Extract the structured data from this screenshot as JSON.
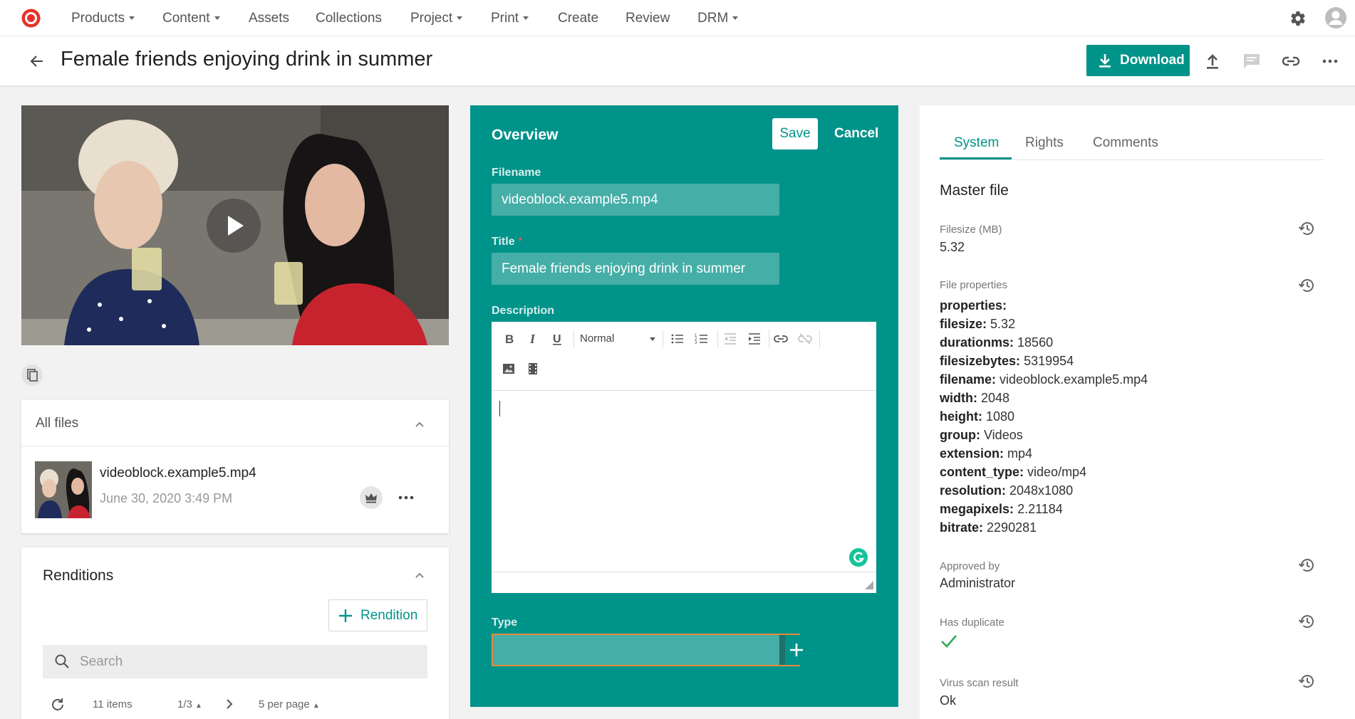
{
  "nav": {
    "items": [
      {
        "label": "Products",
        "dropdown": true
      },
      {
        "label": "Content",
        "dropdown": true
      },
      {
        "label": "Assets",
        "dropdown": false
      },
      {
        "label": "Collections",
        "dropdown": false
      },
      {
        "label": "Project",
        "dropdown": true
      },
      {
        "label": "Print",
        "dropdown": true
      },
      {
        "label": "Create",
        "dropdown": false
      },
      {
        "label": "Review",
        "dropdown": false
      },
      {
        "label": "DRM",
        "dropdown": true
      }
    ]
  },
  "header": {
    "title": "Female friends enjoying drink in summer",
    "download_label": "Download"
  },
  "all_files": {
    "title": "All files",
    "file": {
      "name": "videoblock.example5.mp4",
      "date": "June 30, 2020 3:49 PM"
    }
  },
  "renditions": {
    "title": "Renditions",
    "add_label": "Rendition",
    "search_placeholder": "Search",
    "items_count": "11 items",
    "page": "1/3",
    "per_page": "5 per page"
  },
  "overview": {
    "title": "Overview",
    "save_label": "Save",
    "cancel_label": "Cancel",
    "filename_label": "Filename",
    "filename_value": "videoblock.example5.mp4",
    "title_label": "Title",
    "title_required": "*",
    "title_value": "Female friends enjoying drink in summer",
    "description_label": "Description",
    "format_value": "Normal",
    "type_label": "Type"
  },
  "system": {
    "tabs": [
      "System",
      "Rights",
      "Comments"
    ],
    "active_tab": "System",
    "master_title": "Master file",
    "filesize_label": "Filesize (MB)",
    "filesize_value": "5.32",
    "file_properties_label": "File properties",
    "properties": [
      {
        "key": "properties:",
        "value": ""
      },
      {
        "key": "filesize:",
        "value": "5.32"
      },
      {
        "key": "durationms:",
        "value": "18560"
      },
      {
        "key": "filesizebytes:",
        "value": "5319954"
      },
      {
        "key": "filename:",
        "value": "videoblock.example5.mp4"
      },
      {
        "key": "width:",
        "value": "2048"
      },
      {
        "key": "height:",
        "value": "1080"
      },
      {
        "key": "group:",
        "value": "Videos"
      },
      {
        "key": "extension:",
        "value": "mp4"
      },
      {
        "key": "content_type:",
        "value": "video/mp4"
      },
      {
        "key": "resolution:",
        "value": "2048x1080"
      },
      {
        "key": "megapixels:",
        "value": "2.21184"
      },
      {
        "key": "bitrate:",
        "value": "2290281"
      }
    ],
    "approved_by_label": "Approved by",
    "approved_by_value": "Administrator",
    "has_duplicate_label": "Has duplicate",
    "virus_scan_label": "Virus scan result",
    "virus_scan_value": "Ok"
  },
  "colors": {
    "accent": "#00938a",
    "field_bg": "#45aea7",
    "focus_border": "#e58a3a",
    "check": "#2eaa53"
  },
  "icons": [
    "logo-icon",
    "settings-gear-icon",
    "user-avatar-icon",
    "back-arrow-icon",
    "download-icon",
    "upload-icon",
    "comment-icon",
    "link-icon",
    "more-horizontal-icon",
    "play-icon",
    "copy-icon",
    "chevron-up-icon",
    "crown-icon",
    "plus-icon",
    "search-icon",
    "refresh-icon",
    "history-icon",
    "check-icon"
  ]
}
